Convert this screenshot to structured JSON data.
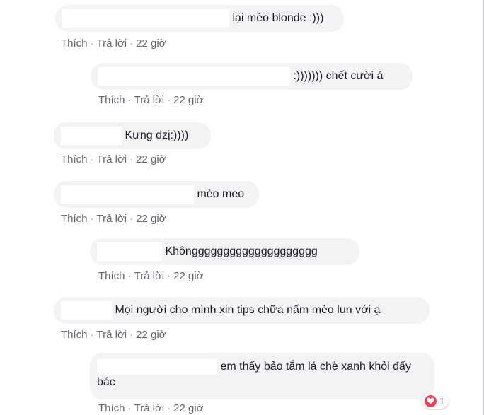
{
  "comments": [
    {
      "text": "lại mèo blonde :)))",
      "like": "Thích",
      "reply": "Trả lời",
      "time": "22 giờ"
    },
    {
      "text": ":))))))) chết cười á",
      "like": "Thích",
      "reply": "Trả lời",
      "time": "22 giờ"
    },
    {
      "text": "Kưng dzị:))))",
      "like": "Thích",
      "reply": "Trả lời",
      "time": "22 giờ"
    },
    {
      "text": "mèo meo",
      "like": "Thích",
      "reply": "Trả lời",
      "time": "22 giờ"
    },
    {
      "text": "Khôngggggggggggggggggggg",
      "like": "Thích",
      "reply": "Trả lời",
      "time": "22 giờ"
    },
    {
      "text": "Mọi người cho mình xin tips chữa nấm mèo lun với ạ",
      "like": "Thích",
      "reply": "Trả lời",
      "time": "22 giờ"
    },
    {
      "text": "em thấy bảo tắm lá chè xanh khỏi đấy bác",
      "like": "Thích",
      "reply": "Trả lời",
      "time": "22 giờ",
      "reaction_count": "1",
      "reaction_icon": "heart-icon"
    }
  ],
  "colors": {
    "bubble": "#f2f3f5",
    "meta": "#616770",
    "heart": "#f33e58"
  }
}
